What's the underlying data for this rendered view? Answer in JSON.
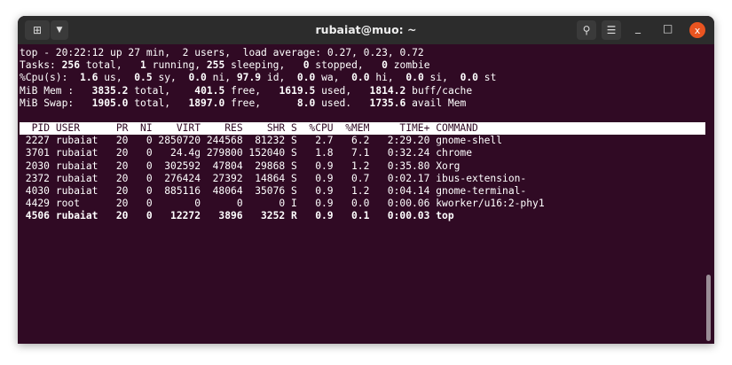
{
  "window": {
    "title": "rubaiat@muo: ~",
    "new_tab_icon": "new-tab-icon",
    "menu_dropdown_icon": "chevron-down-icon",
    "search_icon": "search-icon",
    "menu_icon": "hamburger-icon",
    "minimize_label": "_",
    "maximize_label": "□",
    "close_label": "x"
  },
  "summary": [
    [
      [
        "top - 20:22:12 up 27 min,  2 users,  load average: 0.27, 0.23, 0.72",
        false
      ]
    ],
    [
      [
        "Tasks: ",
        false
      ],
      [
        "256",
        true
      ],
      [
        " total,   ",
        false
      ],
      [
        "1",
        true
      ],
      [
        " running, ",
        false
      ],
      [
        "255",
        true
      ],
      [
        " sleeping,   ",
        false
      ],
      [
        "0",
        true
      ],
      [
        " stopped,   ",
        false
      ],
      [
        "0",
        true
      ],
      [
        " zombie",
        false
      ]
    ],
    [
      [
        "%Cpu(s):  ",
        false
      ],
      [
        "1.6",
        true
      ],
      [
        " us,  ",
        false
      ],
      [
        "0.5",
        true
      ],
      [
        " sy,  ",
        false
      ],
      [
        "0.0",
        true
      ],
      [
        " ni, ",
        false
      ],
      [
        "97.9",
        true
      ],
      [
        " id,  ",
        false
      ],
      [
        "0.0",
        true
      ],
      [
        " wa,  ",
        false
      ],
      [
        "0.0",
        true
      ],
      [
        " hi,  ",
        false
      ],
      [
        "0.0",
        true
      ],
      [
        " si,  ",
        false
      ],
      [
        "0.0",
        true
      ],
      [
        " st",
        false
      ]
    ],
    [
      [
        "MiB Mem :   ",
        false
      ],
      [
        "3835.2",
        true
      ],
      [
        " total,    ",
        false
      ],
      [
        "401.5",
        true
      ],
      [
        " free,   ",
        false
      ],
      [
        "1619.5",
        true
      ],
      [
        " used,   ",
        false
      ],
      [
        "1814.2",
        true
      ],
      [
        " buff/cache",
        false
      ]
    ],
    [
      [
        "MiB Swap:   ",
        false
      ],
      [
        "1905.0",
        true
      ],
      [
        " total,   ",
        false
      ],
      [
        "1897.0",
        true
      ],
      [
        " free,      ",
        false
      ],
      [
        "8.0",
        true
      ],
      [
        " used.   ",
        false
      ],
      [
        "1735.6",
        true
      ],
      [
        " avail Mem",
        false
      ]
    ]
  ],
  "table": {
    "headers": [
      "PID",
      "USER",
      "PR",
      "NI",
      "VIRT",
      "RES",
      "SHR",
      "S",
      "%CPU",
      "%MEM",
      "TIME+",
      "COMMAND"
    ],
    "rows": [
      [
        "2227",
        "rubaiat",
        "20",
        "0",
        "2850720",
        "244568",
        "81232",
        "S",
        "2.7",
        "6.2",
        "2:29.20",
        "gnome-shell"
      ],
      [
        "3701",
        "rubaiat",
        "20",
        "0",
        "24.4g",
        "279800",
        "152040",
        "S",
        "1.8",
        "7.1",
        "0:32.24",
        "chrome"
      ],
      [
        "2030",
        "rubaiat",
        "20",
        "0",
        "302592",
        "47804",
        "29868",
        "S",
        "0.9",
        "1.2",
        "0:35.80",
        "Xorg"
      ],
      [
        "2372",
        "rubaiat",
        "20",
        "0",
        "276424",
        "27392",
        "14864",
        "S",
        "0.9",
        "0.7",
        "0:02.17",
        "ibus-extension-"
      ],
      [
        "4030",
        "rubaiat",
        "20",
        "0",
        "885116",
        "48064",
        "35076",
        "S",
        "0.9",
        "1.2",
        "0:04.14",
        "gnome-terminal-"
      ],
      [
        "4429",
        "root",
        "20",
        "0",
        "0",
        "0",
        "0",
        "I",
        "0.9",
        "0.0",
        "0:00.06",
        "kworker/u16:2-phy1"
      ],
      [
        "4506",
        "rubaiat",
        "20",
        "0",
        "12272",
        "3896",
        "3252",
        "R",
        "0.9",
        "0.1",
        "0:00.03",
        "top"
      ]
    ],
    "bold_row_index": 6
  }
}
